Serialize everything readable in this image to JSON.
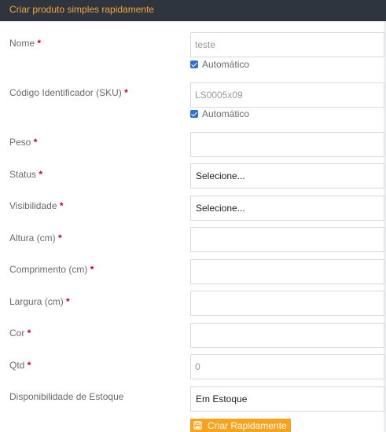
{
  "header": {
    "title": "Criar produto simples rapidamente"
  },
  "required_mark": "*",
  "fields": {
    "nome": {
      "label": "Nome",
      "value": "teste",
      "auto_label": "Automático"
    },
    "sku": {
      "label": "Código Identificador (SKU)",
      "value": "LS0005x09",
      "auto_label": "Automático"
    },
    "peso": {
      "label": "Peso",
      "value": ""
    },
    "status": {
      "label": "Status",
      "selected": "Selecione..."
    },
    "visibilidade": {
      "label": "Visibilidade",
      "selected": "Selecione..."
    },
    "altura": {
      "label": "Altura (cm)",
      "value": ""
    },
    "comprimento": {
      "label": "Comprimento (cm)",
      "value": ""
    },
    "largura": {
      "label": "Largura (cm)",
      "value": ""
    },
    "cor": {
      "label": "Cor",
      "value": ""
    },
    "qtd": {
      "label": "Qtd",
      "value": "0"
    },
    "disponibilidade": {
      "label": "Disponibilidade de Estoque",
      "selected": "Em Estoque"
    }
  },
  "actions": {
    "submit_label": "Criar Rapidamente",
    "submit_icon": "floppy-disk-icon"
  },
  "colors": {
    "header_bg": "#2f353f",
    "header_text": "#f4a63a",
    "button_bg": "#f7a31c",
    "required": "#c4002f"
  }
}
